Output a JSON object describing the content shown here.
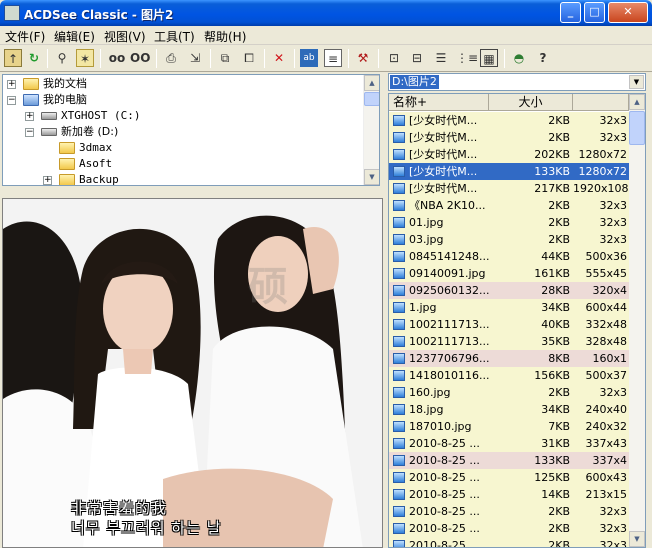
{
  "window": {
    "title": "ACDSee Classic - 图片2",
    "minimize": "_",
    "maximize": "□",
    "close": "✕"
  },
  "menu": [
    {
      "label": "文件(F)"
    },
    {
      "label": "编辑(E)"
    },
    {
      "label": "视图(V)"
    },
    {
      "label": "工具(T)"
    },
    {
      "label": "帮助(H)"
    }
  ],
  "tree": {
    "items": [
      {
        "label": "我的文档",
        "expander": "+",
        "icon": "folder-documents-icon"
      },
      {
        "label": "我的电脑",
        "expander": "−",
        "icon": "computer-icon"
      },
      {
        "label": "XTGHOST (C:)",
        "expander": "+",
        "icon": "drive-icon"
      },
      {
        "label": "新加卷 (D:)",
        "expander": "−",
        "icon": "drive-icon"
      },
      {
        "label": "3dmax",
        "expander": "",
        "icon": "folder-icon"
      },
      {
        "label": "Asoft",
        "expander": "",
        "icon": "folder-icon"
      },
      {
        "label": "Backup",
        "expander": "+",
        "icon": "folder-icon"
      }
    ]
  },
  "preview": {
    "subtitle_line1": "非常害羞的我",
    "subtitle_line2": "너무 부끄러워 하는 날",
    "watermark": "硕"
  },
  "address": {
    "value": "D:\\图片2"
  },
  "filelist": {
    "headers": {
      "name": "名称+",
      "size": "大小",
      "dims": ""
    },
    "rows": [
      {
        "name": "[少女时代M...",
        "size": "2KB",
        "dims": "32x3"
      },
      {
        "name": "[少女时代M...",
        "size": "2KB",
        "dims": "32x3"
      },
      {
        "name": "[少女时代M...",
        "size": "202KB",
        "dims": "1280x72"
      },
      {
        "name": "[少女时代M...",
        "size": "133KB",
        "dims": "1280x72",
        "selected": true
      },
      {
        "name": "[少女时代M...",
        "size": "217KB",
        "dims": "1920x108"
      },
      {
        "name": "《NBA 2K10...",
        "size": "2KB",
        "dims": "32x3"
      },
      {
        "name": "01.jpg",
        "size": "2KB",
        "dims": "32x3"
      },
      {
        "name": "03.jpg",
        "size": "2KB",
        "dims": "32x3"
      },
      {
        "name": "0845141248...",
        "size": "44KB",
        "dims": "500x36"
      },
      {
        "name": "09140091.jpg",
        "size": "161KB",
        "dims": "555x45"
      },
      {
        "name": "0925060132...",
        "size": "28KB",
        "dims": "320x4",
        "alt": true
      },
      {
        "name": "1.jpg",
        "size": "34KB",
        "dims": "600x44"
      },
      {
        "name": "1002111713...",
        "size": "40KB",
        "dims": "332x48"
      },
      {
        "name": "1002111713...",
        "size": "35KB",
        "dims": "328x48"
      },
      {
        "name": "1237706796...",
        "size": "8KB",
        "dims": "160x1",
        "alt": true
      },
      {
        "name": "1418010116...",
        "size": "156KB",
        "dims": "500x37"
      },
      {
        "name": "160.jpg",
        "size": "2KB",
        "dims": "32x3"
      },
      {
        "name": "18.jpg",
        "size": "34KB",
        "dims": "240x40"
      },
      {
        "name": "187010.jpg",
        "size": "7KB",
        "dims": "240x32"
      },
      {
        "name": "2010-8-25 ...",
        "size": "31KB",
        "dims": "337x43"
      },
      {
        "name": "2010-8-25 ...",
        "size": "133KB",
        "dims": "337x4",
        "alt": true
      },
      {
        "name": "2010-8-25 ...",
        "size": "125KB",
        "dims": "600x43"
      },
      {
        "name": "2010-8-25 ...",
        "size": "14KB",
        "dims": "213x15"
      },
      {
        "name": "2010-8-25 ...",
        "size": "2KB",
        "dims": "32x3"
      },
      {
        "name": "2010-8-25 ...",
        "size": "2KB",
        "dims": "32x3"
      },
      {
        "name": "2010-8-25 ...",
        "size": "2KB",
        "dims": "32x3"
      }
    ]
  },
  "colors": {
    "selection": "#316ac5",
    "row_bg": "#f7f6d0",
    "row_alt_bg": "#eddbd7"
  }
}
